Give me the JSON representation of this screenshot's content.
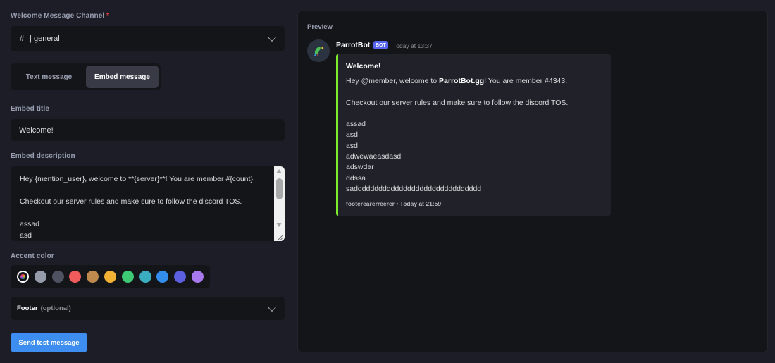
{
  "channel": {
    "label": "Welcome Message Channel",
    "required_mark": "*",
    "hash": "#",
    "value": "| general"
  },
  "message_type": {
    "options": [
      "Text message",
      "Embed message"
    ],
    "selected": "Embed message"
  },
  "embed_title": {
    "label": "Embed title",
    "value": "Welcome!"
  },
  "embed_description": {
    "label": "Embed description",
    "value": "Hey {mention_user}, welcome to **{server}**! You are member #{count}.\n\nCheckout our server rules and make sure to follow the discord TOS.\n\nassad\nasd"
  },
  "accent_color": {
    "label": "Accent color",
    "swatches": [
      "custom",
      "#959bab",
      "#4f5361",
      "#f05b5b",
      "#c08a4e",
      "#f2b135",
      "#3ec975",
      "#3aaec0",
      "#328dec",
      "#5c5fe0",
      "#a879ec"
    ],
    "selected": "custom"
  },
  "footer": {
    "label": "Footer",
    "optional": "(optional)"
  },
  "send_button": "Send test message",
  "preview": {
    "label": "Preview",
    "bot_name": "ParrotBot",
    "bot_badge": "BOT",
    "timestamp": "Today at 13:37",
    "embed": {
      "accent": "#7dec2c",
      "title": "Welcome!",
      "line1_pre": "Hey @member, welcome to ",
      "line1_bold": "ParrotBot.gg",
      "line1_post": "! You are member #4343.",
      "rest": "\nCheckout our server rules and make sure to follow the discord TOS.\n\nassad\nasd\nasd\nadwewaeasdasd\nadswdar\nddssa\nsaddddddddddddddddddddddddddddddd",
      "footer": "footerearerreerer • Today at 21:59"
    }
  }
}
